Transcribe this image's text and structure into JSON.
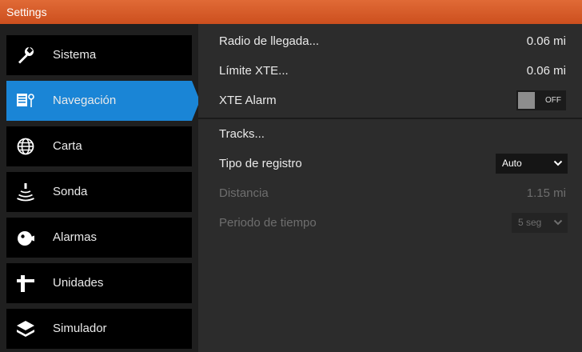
{
  "window": {
    "title": "Settings"
  },
  "colors": {
    "titlebar": "#d95a28",
    "accent": "#1a85d6",
    "sidebar_bg": "#1f1f1f",
    "panel_bg": "#2c2c2c",
    "disabled_text": "#6e6e6e"
  },
  "sidebar": {
    "items": [
      {
        "label": "Sistema",
        "icon": "wrench-icon",
        "active": false
      },
      {
        "label": "Navegación",
        "icon": "navigation-icon",
        "active": true
      },
      {
        "label": "Carta",
        "icon": "globe-icon",
        "active": false
      },
      {
        "label": "Sonda",
        "icon": "sonar-icon",
        "active": false
      },
      {
        "label": "Alarmas",
        "icon": "alarm-icon",
        "active": false
      },
      {
        "label": "Unidades",
        "icon": "units-icon",
        "active": false
      },
      {
        "label": "Simulador",
        "icon": "layers-icon",
        "active": false
      }
    ]
  },
  "settings": {
    "arrival_radius": {
      "label": "Radio de llegada...",
      "value": "0.06 mi"
    },
    "xte_limit": {
      "label": "Límite XTE...",
      "value": "0.06 mi"
    },
    "xte_alarm": {
      "label": "XTE Alarm",
      "state": "OFF"
    },
    "tracks": {
      "label": "Tracks..."
    },
    "log_type": {
      "label": "Tipo de registro",
      "value": "Auto"
    },
    "distance": {
      "label": "Distancia",
      "value": "1.15 mi",
      "enabled": false
    },
    "time_period": {
      "label": "Periodo de tiempo",
      "value": "5 seg",
      "enabled": false
    }
  }
}
